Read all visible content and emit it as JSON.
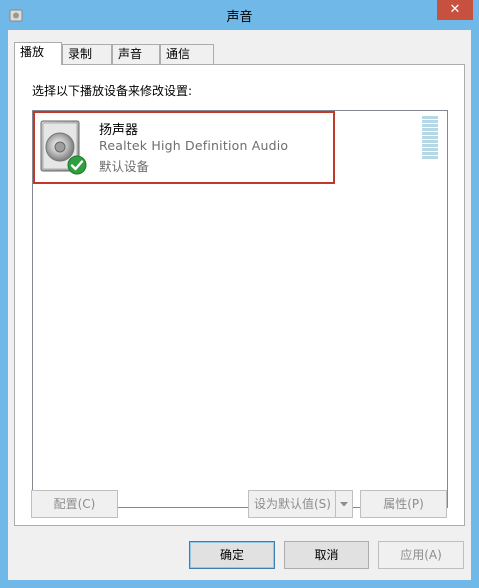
{
  "window": {
    "title": "声音",
    "close_label": "✕"
  },
  "tabs": [
    {
      "label": "播放"
    },
    {
      "label": "录制"
    },
    {
      "label": "声音"
    },
    {
      "label": "通信"
    }
  ],
  "panel": {
    "instruction": "选择以下播放设备来修改设置:"
  },
  "device": {
    "name": "扬声器",
    "driver": "Realtek High Definition Audio",
    "status": "默认设备",
    "icon": "speaker-icon",
    "badge_icon": "check-icon"
  },
  "buttons": {
    "configure": "配置(C)",
    "set_default": "设为默认值(S)",
    "properties": "属性(P)",
    "ok": "确定",
    "cancel": "取消",
    "apply": "应用(A)"
  },
  "colors": {
    "highlight_border": "#c0392b",
    "close_button": "#c7503f",
    "title_bar": "#6fb8e8",
    "check_badge": "#2e9e3e"
  }
}
